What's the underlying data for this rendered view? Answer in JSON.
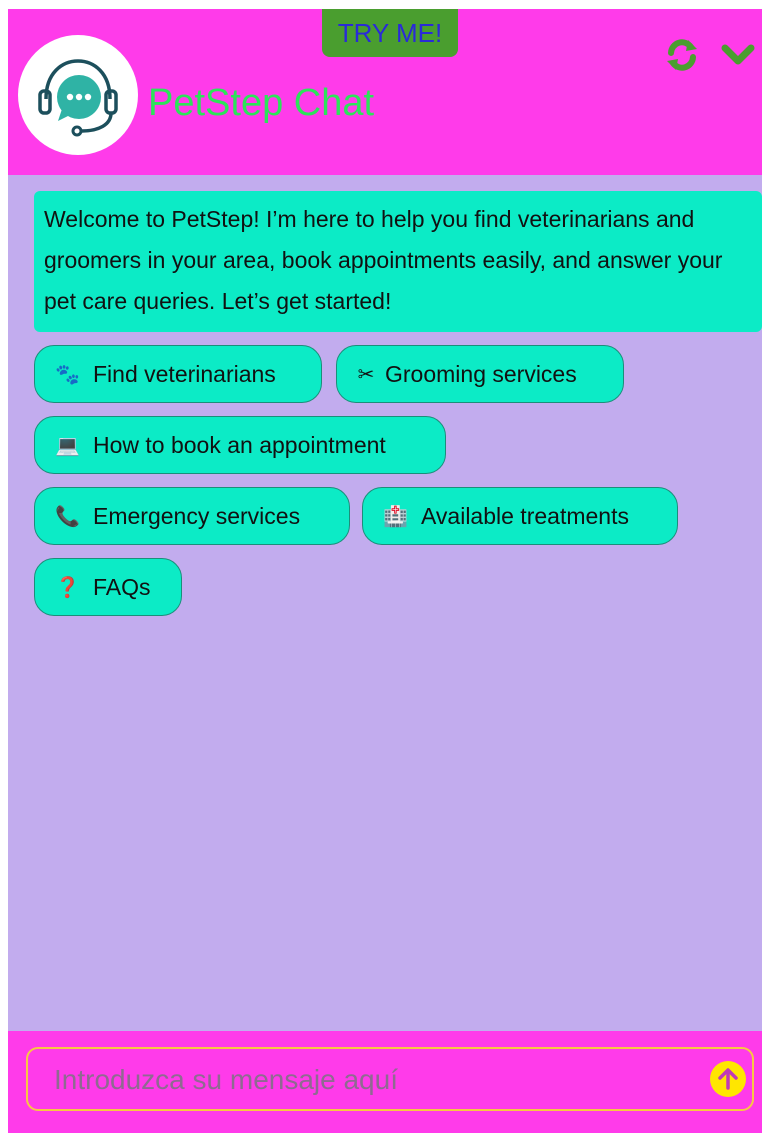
{
  "header": {
    "try_me": "TRY ME!",
    "title": "PetStep Chat"
  },
  "welcome_message": "Welcome to PetStep! I’m here to help you find veterinarians and groomers in your area, book appointments easily, and answer your pet care queries. Let’s get started!",
  "quick_replies": [
    {
      "icon": "paw-prints-icon",
      "glyph": "🐾",
      "label": "Find veterinarians"
    },
    {
      "icon": "scissors-icon",
      "glyph": "✂",
      "label": "Grooming services"
    },
    {
      "icon": "laptop-icon",
      "glyph": "💻",
      "label": "How to book an appointment"
    },
    {
      "icon": "phone-icon",
      "glyph": "📞",
      "label": "Emergency services"
    },
    {
      "icon": "hospital-icon",
      "glyph": "🏥",
      "label": "Available treatments"
    },
    {
      "icon": "question-mark-icon",
      "glyph": "❓",
      "label": "FAQs"
    }
  ],
  "input": {
    "placeholder": "Introduzca su mensaje aquí",
    "value": ""
  },
  "colors": {
    "header": "#ff3bea",
    "body": "#c2acee",
    "bubble": "#0cebc6",
    "title": "#2de35a",
    "try_me_bg": "#4a9e2f",
    "try_me_text": "#2a2ad8",
    "send": "#ffe600"
  }
}
